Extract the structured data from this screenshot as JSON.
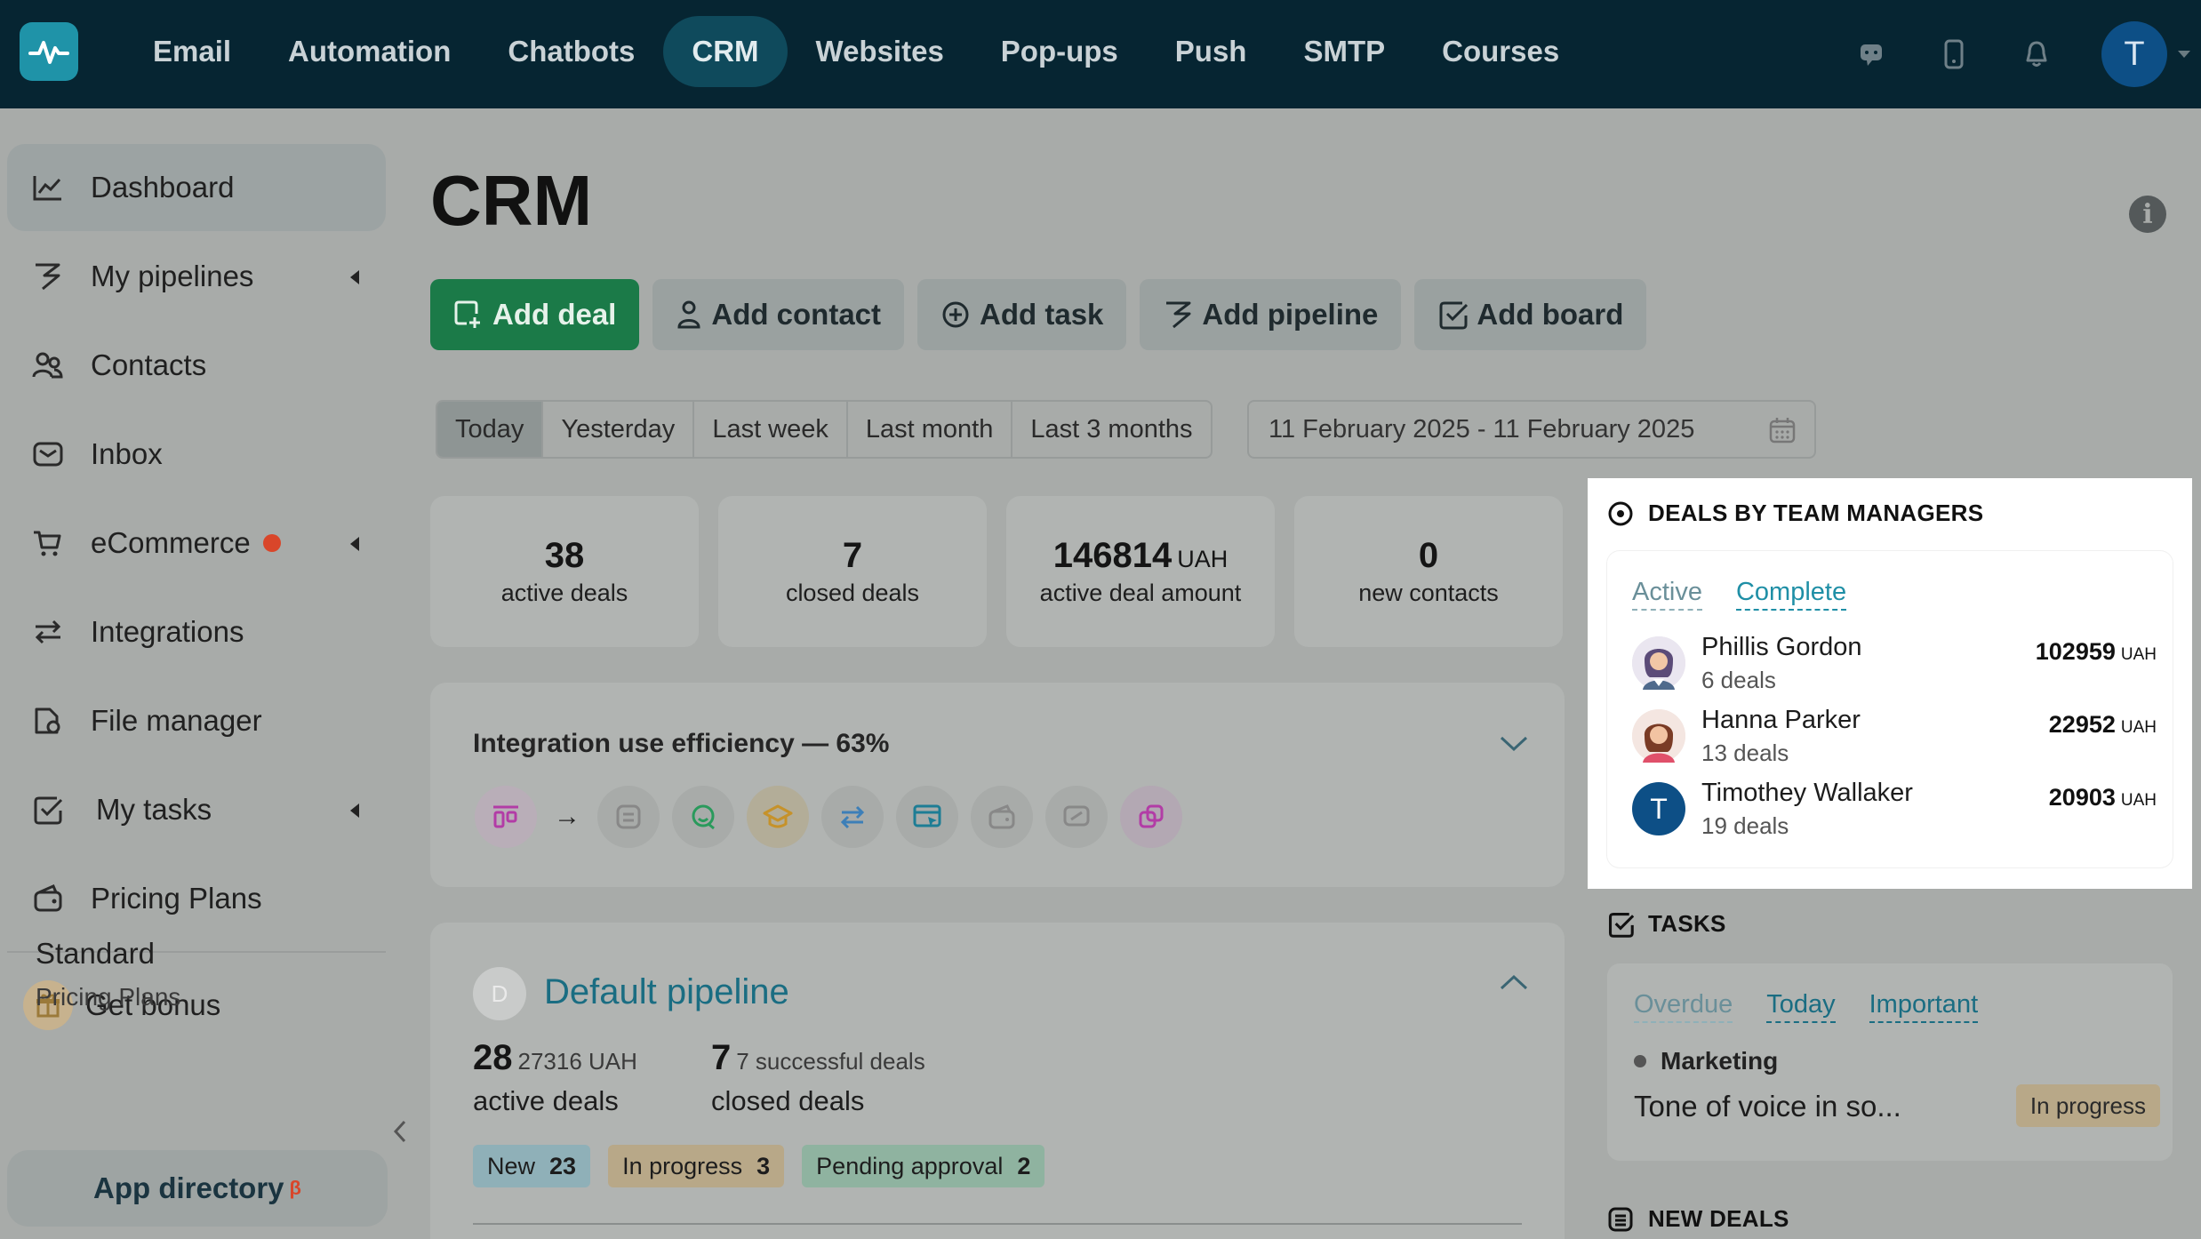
{
  "nav": {
    "items": [
      "Email",
      "Automation",
      "Chatbots",
      "CRM",
      "Websites",
      "Pop-ups",
      "Push",
      "SMTP",
      "Courses"
    ],
    "active": "CRM",
    "avatar_letter": "T"
  },
  "sidebar": {
    "items": [
      {
        "label": "Dashboard",
        "icon": "chart-line-icon",
        "active": true
      },
      {
        "label": "My pipelines",
        "icon": "pipeline-icon",
        "expandable": true
      },
      {
        "label": "Contacts",
        "icon": "contacts-icon"
      },
      {
        "label": "Inbox",
        "icon": "inbox-icon"
      },
      {
        "label": "eCommerce",
        "icon": "cart-icon",
        "expandable": true,
        "has_alert_dot": true
      },
      {
        "label": "Integrations",
        "icon": "integrations-icon"
      },
      {
        "label": "File manager",
        "icon": "file-icon"
      },
      {
        "label": "My tasks",
        "icon": "tasks-icon",
        "expandable": true
      },
      {
        "label": "Pricing Plans",
        "icon": "wallet-icon"
      }
    ],
    "bonus_label": "Get bonus",
    "plan_name": "Standard",
    "plan_sub": "Pricing Plans",
    "app_directory_label": "App directory",
    "app_directory_badge": "β"
  },
  "main": {
    "title": "CRM",
    "actions": [
      "Add deal",
      "Add contact",
      "Add task",
      "Add pipeline",
      "Add board"
    ],
    "periods": [
      "Today",
      "Yesterday",
      "Last week",
      "Last month",
      "Last 3 months"
    ],
    "active_period": "Today",
    "date_range": "11 February 2025 - 11 February 2025",
    "stats": [
      {
        "value": "38",
        "unit": "",
        "caption": "active deals"
      },
      {
        "value": "7",
        "unit": "",
        "caption": "closed deals"
      },
      {
        "value": "146814",
        "unit": "UAH",
        "caption": "active deal amount"
      },
      {
        "value": "0",
        "unit": "",
        "caption": "new contacts"
      }
    ],
    "efficiency": {
      "title": "Integration use efficiency — 63%"
    },
    "pipeline": {
      "badge_letter": "D",
      "name": "Default pipeline",
      "active_count": "28",
      "active_amount": "27316 UAH",
      "active_caption": "active deals",
      "closed_count": "7",
      "closed_sub": "7 successful deals",
      "closed_caption": "closed deals",
      "chips": [
        {
          "label": "New",
          "count": "23",
          "color": "#8fb0b8"
        },
        {
          "label": "In progress",
          "count": "3",
          "color": "#b8a888"
        },
        {
          "label": "Pending approval",
          "count": "2",
          "color": "#8fb3a0"
        }
      ]
    }
  },
  "managers_panel": {
    "title": "DEALS BY TEAM MANAGERS",
    "tabs": [
      "Active",
      "Complete"
    ],
    "rows": [
      {
        "name": "Phillis Gordon",
        "deals": "6 deals",
        "amount": "102959",
        "unit": "UAH"
      },
      {
        "name": "Hanna Parker",
        "deals": "13 deals",
        "amount": "22952",
        "unit": "UAH"
      },
      {
        "name": "Timothey Wallaker",
        "deals": "19 deals",
        "amount": "20903",
        "unit": "UAH",
        "initial": "T"
      }
    ]
  },
  "tasks_panel": {
    "title": "TASKS",
    "tabs": [
      "Overdue",
      "Today",
      "Important"
    ],
    "category": "Marketing",
    "task": "Tone of voice in so...",
    "status": "In progress"
  },
  "new_deals_panel": {
    "title": "NEW DEALS"
  },
  "colors": {
    "nav_bg": "#062532",
    "accent": "#1f8fa6",
    "primary_button": "#1b7a48",
    "alert": "#d9462a"
  }
}
